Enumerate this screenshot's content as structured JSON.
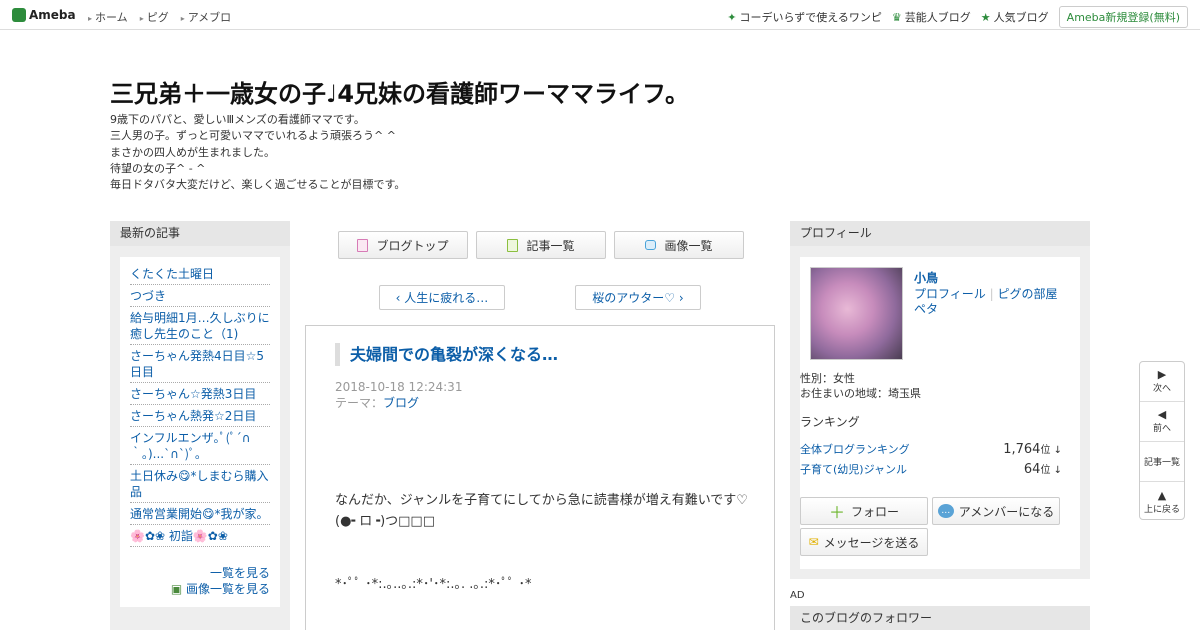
{
  "top": {
    "logo": "Ameba",
    "nav": [
      "ホーム",
      "ピグ",
      "アメブロ"
    ],
    "links": [
      "コーデいらずで使えるワンピ",
      "芸能人ブログ",
      "人気ブログ"
    ],
    "register": "Ameba新規登録(無料)"
  },
  "blog": {
    "title": "三兄弟＋一歳女の子♩4兄妹の看護師ワーママライフ。",
    "desc": [
      "9歳下のパパと、愛しいⅢメンズの看護師ママです。",
      "三人男の子。ずっと可愛いママでいれるよう頑張ろう^ ^",
      "まさかの四人めが生まれました。",
      "待望の女の子^ - ^",
      "毎日ドタバタ大変だけど、楽しく過ごせることが目標です。"
    ]
  },
  "left": {
    "heading": "最新の記事",
    "items": [
      "くたくた土曜日",
      "つづき",
      "給与明細1月…久しぶりに癒し先生のこと（1)",
      "さーちゃん発熱4日目☆5日目",
      "さーちゃん☆発熱3日目",
      "さーちゃん熱発☆2日目",
      "インフルエンザ｡ﾟ(ﾟ´∩｀｡)...`∩`)ﾟ｡",
      "土日休み😋*しまむら購入品",
      "通常営業開始😋*我が家。",
      "🌸✿❀ 初詣🌸✿❀"
    ],
    "more": "一覧を見る",
    "more_images": "画像一覧を見る"
  },
  "center": {
    "buttons": [
      "ブログトップ",
      "記事一覧",
      "画像一覧"
    ],
    "prev": "人生に疲れる…",
    "next": "桜のアウター♡",
    "article": {
      "title": "夫婦間での亀裂が深くなる…",
      "date": "2018-10-18 12:24:31",
      "theme_label": "テーマ：",
      "theme": "ブログ",
      "body": [
        "なんだか、ジャンルを子育てにしてから急に読書様が増え有難いです♡",
        "(●╸ロ╺)つ□□□",
        "*･ﾟﾟ ･*:.｡..｡.:*･'･*:.｡. .｡.:*･ﾟﾟ ･*"
      ]
    }
  },
  "right": {
    "heading": "プロフィール",
    "name": "小鳥",
    "links": [
      "プロフィール",
      "ピグの部屋",
      "ペタ"
    ],
    "gender": "性別：女性",
    "area": "お住まいの地域：埼玉県",
    "ranking_label": "ランキング",
    "rankings": [
      {
        "name": "全体ブログランキング",
        "value": "1,764",
        "unit": "位 ↓"
      },
      {
        "name": "子育て(幼児)ジャンル",
        "value": "64",
        "unit": "位 ↓"
      }
    ],
    "follow": "フォロー",
    "member": "アメンバーになる",
    "message": "メッセージを送る",
    "ad": "AD",
    "followers": "このブログのフォロワー"
  },
  "float": {
    "next": "次へ",
    "prev": "前へ",
    "list": "記事一覧",
    "top": "上に戻る"
  },
  "colors": {
    "brand": "#2d8c3c",
    "link": "#0c5ea8"
  }
}
